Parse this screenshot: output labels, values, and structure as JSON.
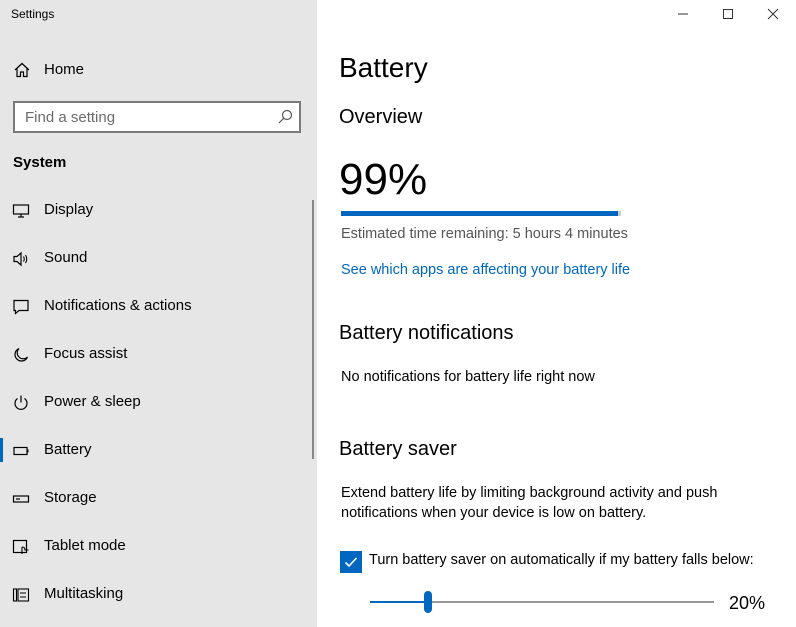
{
  "window": {
    "title": "Settings",
    "minimize_glyph": "─",
    "maximize_glyph": "☐",
    "close_glyph": "✕"
  },
  "sidebar": {
    "home_label": "Home",
    "search_placeholder": "Find a setting",
    "section_title": "System",
    "items": [
      {
        "label": "Display",
        "icon": "display-icon"
      },
      {
        "label": "Sound",
        "icon": "speaker-icon"
      },
      {
        "label": "Notifications & actions",
        "icon": "notification-icon"
      },
      {
        "label": "Focus assist",
        "icon": "moon-icon"
      },
      {
        "label": "Power & sleep",
        "icon": "power-icon"
      },
      {
        "label": "Battery",
        "icon": "battery-icon",
        "active": true
      },
      {
        "label": "Storage",
        "icon": "storage-icon"
      },
      {
        "label": "Tablet mode",
        "icon": "tablet-mode-icon"
      },
      {
        "label": "Multitasking",
        "icon": "multitasking-icon"
      }
    ]
  },
  "main": {
    "title": "Battery",
    "overview_heading": "Overview",
    "battery_percent_text": "99%",
    "battery_level": 0.99,
    "estimate_text": "Estimated time remaining: 5 hours 4 minutes",
    "apps_link": "See which apps are affecting your battery life",
    "notifications_heading": "Battery notifications",
    "notifications_text": "No notifications for battery life right now",
    "saver_heading": "Battery saver",
    "saver_desc_line1": "Extend battery life by limiting background activity and push",
    "saver_desc_line2": "notifications when your device is low on battery.",
    "saver_checkbox_label": "Turn battery saver on automatically if my battery falls below:",
    "saver_checkbox_checked": true,
    "saver_threshold_text": "20%",
    "saver_threshold_fraction": 0.17
  },
  "colors": {
    "accent": "#0067c0",
    "sidebar_bg": "#e6e6e6"
  }
}
